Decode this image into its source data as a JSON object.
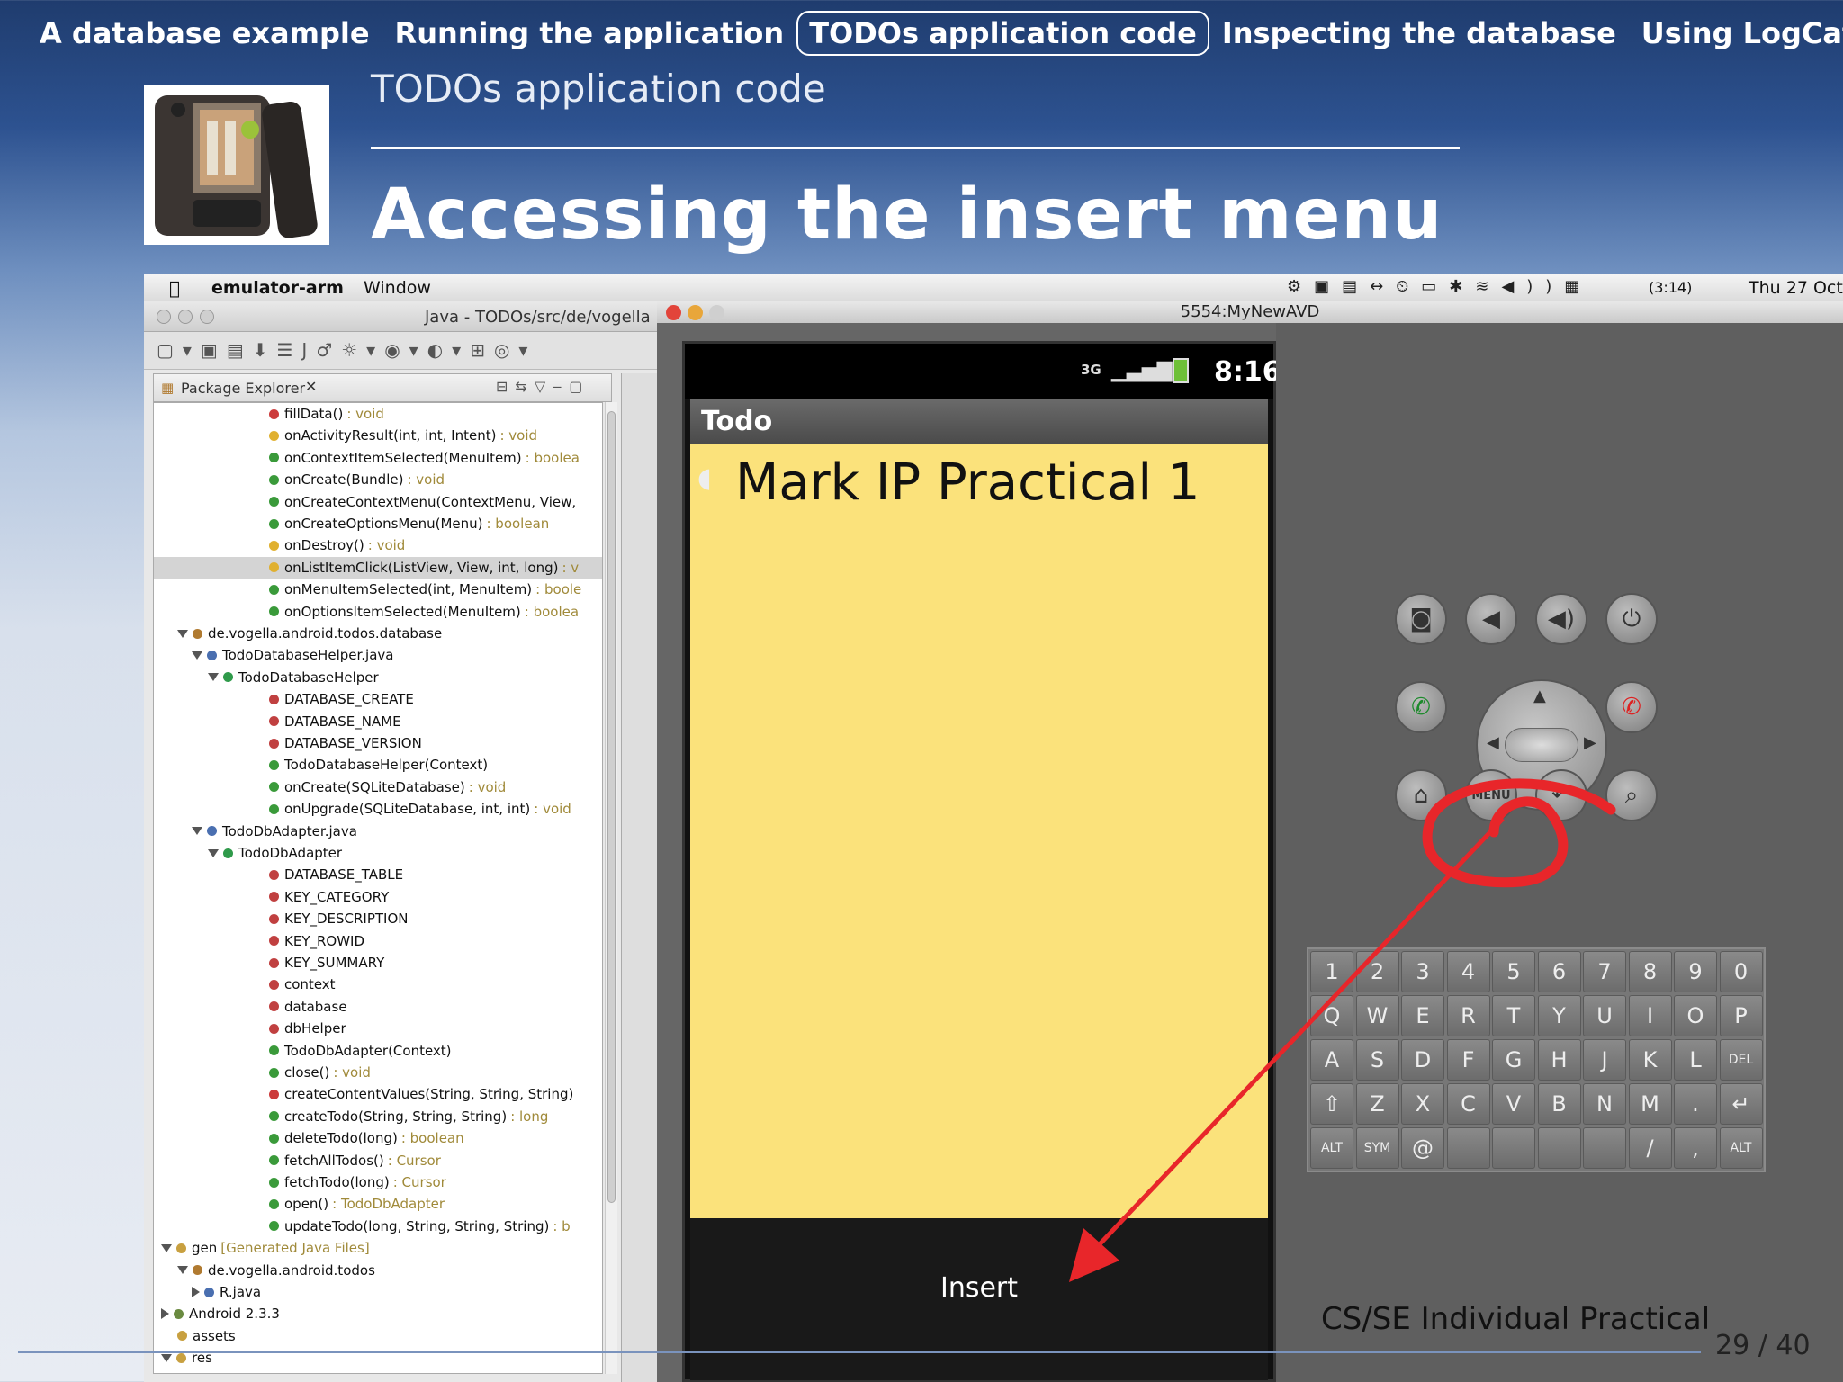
{
  "nav": {
    "items": [
      "A database example",
      "Running the application",
      "TODOs application code",
      "Inspecting the database",
      "Using LogCat"
    ],
    "active_index": 2
  },
  "slide": {
    "subtitle": "TODOs application code",
    "title": "Accessing the insert menu",
    "footer": "CS/SE Individual Practical",
    "page": "29 / 40"
  },
  "mac_menubar": {
    "app": "emulator-arm",
    "menu": "Window",
    "battery": "(3:14)",
    "clock": "Thu 27 Oct"
  },
  "eclipse": {
    "window_title": "Java - TODOs/src/de/vogella",
    "view_title": "Package Explorer",
    "tree": [
      {
        "text": "fillData()",
        "ret": ": void",
        "color": "#cc3b3b"
      },
      {
        "text": "onActivityResult(int, int, Intent)",
        "ret": ": void",
        "color": "#e0b030"
      },
      {
        "text": "onContextItemSelected(MenuItem)",
        "ret": ": boolea",
        "color": "#3a9a3a"
      },
      {
        "text": "onCreate(Bundle)",
        "ret": ": void",
        "color": "#3a9a3a"
      },
      {
        "text": "onCreateContextMenu(ContextMenu, View,",
        "ret": "",
        "color": "#3a9a3a"
      },
      {
        "text": "onCreateOptionsMenu(Menu)",
        "ret": ": boolean",
        "color": "#3a9a3a"
      },
      {
        "text": "onDestroy()",
        "ret": ": void",
        "color": "#e0b030"
      },
      {
        "text": "onListItemClick(ListView, View, int, long)",
        "ret": ": v",
        "color": "#e0b030"
      },
      {
        "text": "onMenuItemSelected(int, MenuItem)",
        "ret": ": boole",
        "color": "#3a9a3a"
      },
      {
        "text": "onOptionsItemSelected(MenuItem)",
        "ret": ": boolea",
        "color": "#3a9a3a"
      },
      {
        "text": "de.vogella.android.todos.database",
        "ret": "",
        "color": "#b07a30"
      },
      {
        "text": "TodoDatabaseHelper.java",
        "ret": "",
        "color": "#4a6fb0"
      },
      {
        "text": "TodoDatabaseHelper",
        "ret": "",
        "color": "#2f9a4a"
      },
      {
        "text": "DATABASE_CREATE",
        "ret": "",
        "color": "#c04040"
      },
      {
        "text": "DATABASE_NAME",
        "ret": "",
        "color": "#c04040"
      },
      {
        "text": "DATABASE_VERSION",
        "ret": "",
        "color": "#c04040"
      },
      {
        "text": "TodoDatabaseHelper(Context)",
        "ret": "",
        "color": "#3a9a3a"
      },
      {
        "text": "onCreate(SQLiteDatabase)",
        "ret": ": void",
        "color": "#3a9a3a"
      },
      {
        "text": "onUpgrade(SQLiteDatabase, int, int)",
        "ret": ": void",
        "color": "#3a9a3a"
      },
      {
        "text": "TodoDbAdapter.java",
        "ret": "",
        "color": "#4a6fb0"
      },
      {
        "text": "TodoDbAdapter",
        "ret": "",
        "color": "#2f9a4a"
      },
      {
        "text": "DATABASE_TABLE",
        "ret": "",
        "color": "#c04040"
      },
      {
        "text": "KEY_CATEGORY",
        "ret": "",
        "color": "#c04040"
      },
      {
        "text": "KEY_DESCRIPTION",
        "ret": "",
        "color": "#c04040"
      },
      {
        "text": "KEY_ROWID",
        "ret": "",
        "color": "#c04040"
      },
      {
        "text": "KEY_SUMMARY",
        "ret": "",
        "color": "#c04040"
      },
      {
        "text": "context",
        "ret": "",
        "color": "#c04040"
      },
      {
        "text": "database",
        "ret": "",
        "color": "#c04040"
      },
      {
        "text": "dbHelper",
        "ret": "",
        "color": "#c04040"
      },
      {
        "text": "TodoDbAdapter(Context)",
        "ret": "",
        "color": "#3a9a3a"
      },
      {
        "text": "close()",
        "ret": ": void",
        "color": "#3a9a3a"
      },
      {
        "text": "createContentValues(String, String, String)",
        "ret": "",
        "color": "#cc3b3b"
      },
      {
        "text": "createTodo(String, String, String)",
        "ret": ": long",
        "color": "#3a9a3a"
      },
      {
        "text": "deleteTodo(long)",
        "ret": ": boolean",
        "color": "#3a9a3a"
      },
      {
        "text": "fetchAllTodos()",
        "ret": ": Cursor",
        "color": "#3a9a3a"
      },
      {
        "text": "fetchTodo(long)",
        "ret": ": Cursor",
        "color": "#3a9a3a"
      },
      {
        "text": "open()",
        "ret": ": TodoDbAdapter",
        "color": "#3a9a3a"
      },
      {
        "text": "updateTodo(long, String, String, String)",
        "ret": ": b",
        "color": "#3a9a3a"
      },
      {
        "text": "gen",
        "ret": "[Generated Java Files]",
        "color": "#c8a040"
      },
      {
        "text": "de.vogella.android.todos",
        "ret": "",
        "color": "#b07a30"
      },
      {
        "text": "R.java",
        "ret": "",
        "color": "#4a6fb0"
      },
      {
        "text": "Android 2.3.3",
        "ret": "",
        "color": "#6a8a40"
      },
      {
        "text": "assets",
        "ret": "",
        "color": "#c8a040"
      },
      {
        "text": "res",
        "ret": "",
        "color": "#c8a040"
      }
    ],
    "selected_index": 7
  },
  "emulator": {
    "window_title": "5554:MyNewAVD",
    "status_time": "8:16",
    "network": "3G",
    "app_title": "Todo",
    "todo_item": "Mark IP Practical 1",
    "menu_option": "Insert",
    "menu_key_label": "MENU",
    "keyboard_rows": [
      [
        "1",
        "2",
        "3",
        "4",
        "5",
        "6",
        "7",
        "8",
        "9",
        "0"
      ],
      [
        "Q",
        "W",
        "E",
        "R",
        "T",
        "Y",
        "U",
        "I",
        "O",
        "P"
      ],
      [
        "A",
        "S",
        "D",
        "F",
        "G",
        "H",
        "J",
        "K",
        "L",
        "DEL"
      ],
      [
        "⇧",
        "Z",
        "X",
        "C",
        "V",
        "B",
        "N",
        "M",
        ".",
        "↵"
      ],
      [
        "ALT",
        "SYM",
        "@",
        "",
        "",
        "",
        "",
        "/",
        ",",
        "ALT"
      ]
    ]
  }
}
